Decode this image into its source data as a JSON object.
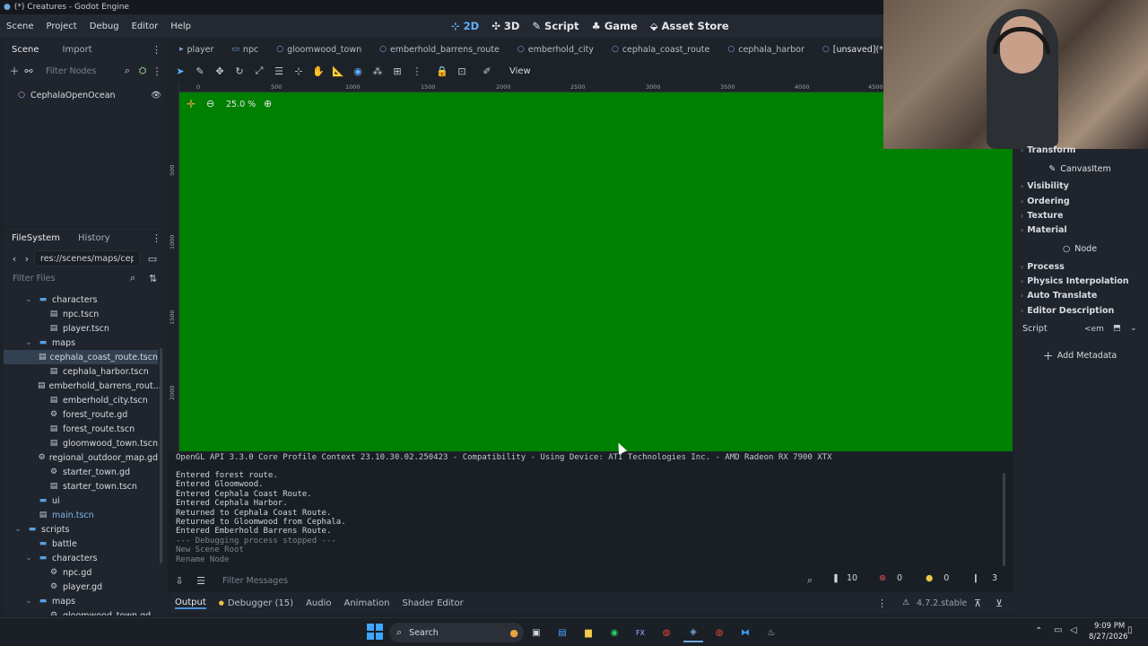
{
  "window": {
    "title": "(*) Creatures - Godot Engine"
  },
  "menu": [
    "Scene",
    "Project",
    "Debug",
    "Editor",
    "Help"
  ],
  "main_switcher": [
    {
      "label": "2D",
      "icon": "2d-icon",
      "active": true
    },
    {
      "label": "3D",
      "icon": "3d-icon",
      "active": false
    },
    {
      "label": "Script",
      "icon": "script-icon",
      "active": false
    },
    {
      "label": "Game",
      "icon": "game-icon",
      "active": false
    },
    {
      "label": "Asset Store",
      "icon": "asset-store-icon",
      "active": false
    }
  ],
  "scene_dock": {
    "tabs": [
      "Scene",
      "Import"
    ],
    "filter_placeholder": "Filter Nodes",
    "root_node": "CephalaOpenOcean"
  },
  "filesystem_dock": {
    "tabs": [
      "FileSystem",
      "History"
    ],
    "path": "res://scenes/maps/cepha",
    "filter_placeholder": "Filter Files",
    "items": [
      {
        "label": "characters",
        "type": "folder"
      },
      {
        "label": "npc.tscn",
        "type": "scene"
      },
      {
        "label": "player.tscn",
        "type": "scene"
      },
      {
        "label": "maps",
        "type": "folder"
      },
      {
        "label": "cephala_coast_route.tscn",
        "type": "scene",
        "selected": true
      },
      {
        "label": "cephala_harbor.tscn",
        "type": "scene"
      },
      {
        "label": "emberhold_barrens_rout...",
        "type": "scene"
      },
      {
        "label": "emberhold_city.tscn",
        "type": "scene"
      },
      {
        "label": "forest_route.gd",
        "type": "script"
      },
      {
        "label": "forest_route.tscn",
        "type": "scene"
      },
      {
        "label": "gloomwood_town.tscn",
        "type": "scene"
      },
      {
        "label": "regional_outdoor_map.gd",
        "type": "script"
      },
      {
        "label": "starter_town.gd",
        "type": "script"
      },
      {
        "label": "starter_town.tscn",
        "type": "scene"
      },
      {
        "label": "ui",
        "type": "folder"
      },
      {
        "label": "main.tscn",
        "type": "scene"
      },
      {
        "label": "scripts",
        "type": "folder"
      },
      {
        "label": "battle",
        "type": "folder"
      },
      {
        "label": "characters",
        "type": "folder"
      },
      {
        "label": "npc.gd",
        "type": "script"
      },
      {
        "label": "player.gd",
        "type": "script"
      },
      {
        "label": "maps",
        "type": "folder"
      },
      {
        "label": "gloomwood_town.gd",
        "type": "script"
      }
    ]
  },
  "scene_tabs": [
    "player",
    "npc",
    "gloomwood_town",
    "emberhold_barrens_route",
    "emberhold_city",
    "cephala_coast_route",
    "cephala_harbor",
    "[unsaved](*)"
  ],
  "viewport": {
    "toolbar_view": "View",
    "zoom": "25.0 %",
    "ruler_x": [
      "0",
      "500",
      "1000",
      "1500",
      "2000",
      "2500",
      "3000",
      "3500",
      "4000",
      "4500"
    ],
    "ruler_y": [
      "500",
      "1000",
      "1500",
      "2000"
    ],
    "background_color": "#008000"
  },
  "inspector": {
    "sections": [
      {
        "label": "Transform",
        "kind": "section"
      },
      {
        "label": "CanvasItem",
        "kind": "header"
      },
      {
        "label": "Visibility",
        "kind": "section"
      },
      {
        "label": "Ordering",
        "kind": "section"
      },
      {
        "label": "Texture",
        "kind": "section"
      },
      {
        "label": "Material",
        "kind": "section"
      },
      {
        "label": "Node",
        "kind": "header"
      },
      {
        "label": "Process",
        "kind": "section"
      },
      {
        "label": "Physics Interpolation",
        "kind": "section"
      },
      {
        "label": "Auto Translate",
        "kind": "section"
      },
      {
        "label": "Editor Description",
        "kind": "section"
      }
    ],
    "script_label": "Script",
    "script_value": "<em",
    "add_metadata": "Add Metadata"
  },
  "output": {
    "header_line": "OpenGL API 3.3.0 Core Profile Context 23.10.30.02.250423 - Compatibility - Using Device: ATI Technologies Inc. - AMD Radeon RX 7900 XTX",
    "lines": [
      {
        "text": "Entered forest route.",
        "dim": false
      },
      {
        "text": "Entered Gloomwood.",
        "dim": false
      },
      {
        "text": "Entered Cephala Coast Route.",
        "dim": false
      },
      {
        "text": "Entered Cephala Harbor.",
        "dim": false
      },
      {
        "text": "Returned to Cephala Coast Route.",
        "dim": false
      },
      {
        "text": "Returned to Gloomwood from Cephala.",
        "dim": false
      },
      {
        "text": "Entered Emberhold Barrens Route.",
        "dim": false
      },
      {
        "text": "--- Debugging process stopped ---",
        "dim": true
      },
      {
        "text": "New Scene Root",
        "dim": true
      },
      {
        "text": "Rename Node",
        "dim": true
      }
    ],
    "filter_placeholder": "Filter Messages",
    "counts": {
      "all": "10",
      "errors": "0",
      "warnings": "0",
      "messages": "3"
    }
  },
  "bottom_tabs": [
    "Output",
    "Debugger (15)",
    "Audio",
    "Animation",
    "Shader Editor"
  ],
  "version": "4.7.2.stable",
  "taskbar": {
    "search": "Search",
    "time": "9:09 PM",
    "date": "8/27/2026"
  },
  "colors": {
    "accent": "#5fb1ff",
    "viewport_green": "#008000",
    "error": "#e05252",
    "warning": "#e8c547"
  }
}
